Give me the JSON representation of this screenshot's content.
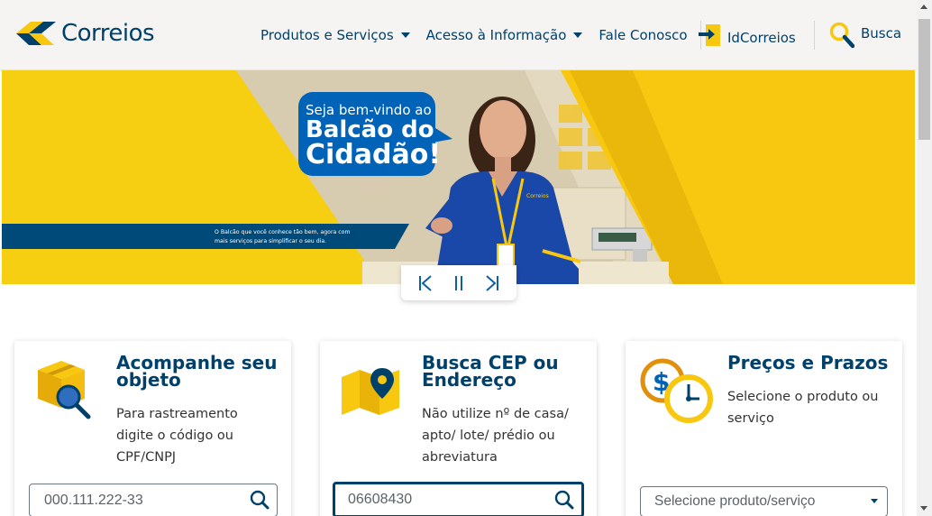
{
  "header": {
    "logo_text": "Correios",
    "nav": [
      {
        "label": "Produtos e Serviços",
        "dropdown": true
      },
      {
        "label": "Acesso à Informação",
        "dropdown": true
      },
      {
        "label": "Fale Conosco",
        "dropdown": false
      }
    ],
    "idcorreios_label": "IdCorreios",
    "search_label": "Busca"
  },
  "banner": {
    "bubble_line1": "Seja bem-vindo ao",
    "bubble_line2": "Balcão do",
    "bubble_line3": "Cidadão!",
    "ribbon_line1": "O Balcão que você conhece tão bem, agora com",
    "ribbon_line2": "mais serviços para simplificar o seu dia.",
    "badge_text": "Correios",
    "controls": {
      "prev": "previous-slide",
      "pause": "pause-slideshow",
      "next": "next-slide"
    }
  },
  "cards": [
    {
      "title_line1": "Acompanhe seu",
      "title_line2": "objeto",
      "desc_lines": [
        "Para rastreamento",
        "digite o código ou",
        "CPF/CNPJ"
      ],
      "input_value": "000.111.222-33",
      "icon": "package-search-icon"
    },
    {
      "title_line1": "Busca CEP ou",
      "title_line2": "Endereço",
      "desc_lines": [
        "Não utilize nº de casa/",
        "apto/ lote/ prédio ou",
        "abreviatura"
      ],
      "input_value": "06608430",
      "icon": "map-pin-icon"
    },
    {
      "title_line1": "Preços e Prazos",
      "desc_lines": [
        "Selecione o produto ou",
        "serviço"
      ],
      "select_value": "Selecione produto/serviço",
      "icon": "price-clock-icon"
    }
  ],
  "colors": {
    "brand_blue": "#00416b",
    "brand_yellow": "#f8c811",
    "header_bg": "#f5f4f2"
  }
}
